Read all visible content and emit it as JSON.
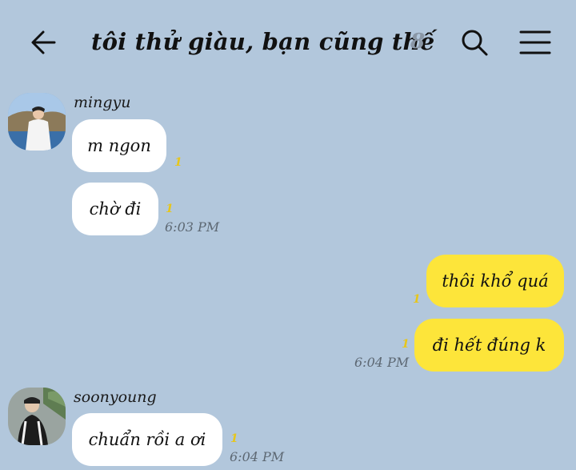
{
  "header": {
    "title": "tôi thử giàu, bạn cũng thế",
    "member_count": "8",
    "back_icon": "arrow-left-icon",
    "search_icon": "search-icon",
    "menu_icon": "hamburger-menu-icon"
  },
  "colors": {
    "background": "#b2c7dc",
    "incoming_bubble": "#ffffff",
    "outgoing_bubble": "#fde53a",
    "unread_marker": "#e7c61a"
  },
  "messages": [
    {
      "sender": "mingyu",
      "text": "m ngon",
      "unread": "1"
    },
    {
      "sender": "mingyu",
      "text": "chờ đi",
      "unread": "1",
      "time": "6:03 PM"
    },
    {
      "sender": "me",
      "text": "thôi khổ quá",
      "unread": "1"
    },
    {
      "sender": "me",
      "text": "đi hết đúng k",
      "unread": "1",
      "time": "6:04 PM"
    },
    {
      "sender": "soonyoung",
      "text": "chuẩn rồi a ơi",
      "unread": "1",
      "time": "6:04 PM"
    }
  ]
}
